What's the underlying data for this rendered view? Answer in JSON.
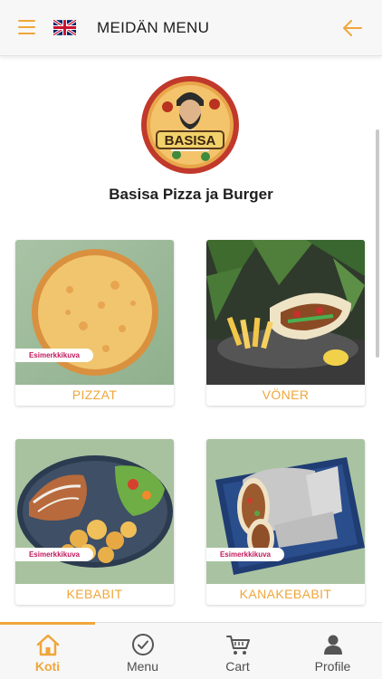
{
  "header": {
    "title": "MEIDÄN MENU",
    "menu_icon": "hamburger-icon",
    "language_icon": "uk-flag-icon",
    "back_icon": "arrow-left-icon"
  },
  "logo": {
    "text": "BASISA"
  },
  "restaurant": {
    "name": "Basisa Pizza ja Burger"
  },
  "categories": [
    {
      "label": "PIZZAT",
      "badge": "Esimerkkikuva"
    },
    {
      "label": "VÖNER",
      "badge": ""
    },
    {
      "label": "KEBABIT",
      "badge": "Esimerkkikuva"
    },
    {
      "label": "KANAKEBABIT",
      "badge": "Esimerkkikuva"
    }
  ],
  "bottom_nav": [
    {
      "label": "Koti",
      "icon": "home-icon",
      "active": true
    },
    {
      "label": "Menu",
      "icon": "check-circle-icon",
      "active": false
    },
    {
      "label": "Cart",
      "icon": "cart-icon",
      "active": false
    },
    {
      "label": "Profile",
      "icon": "user-icon",
      "active": false
    }
  ],
  "colors": {
    "accent": "#f0a63a",
    "badge_text": "#c2185b",
    "background": "#ffffff"
  }
}
